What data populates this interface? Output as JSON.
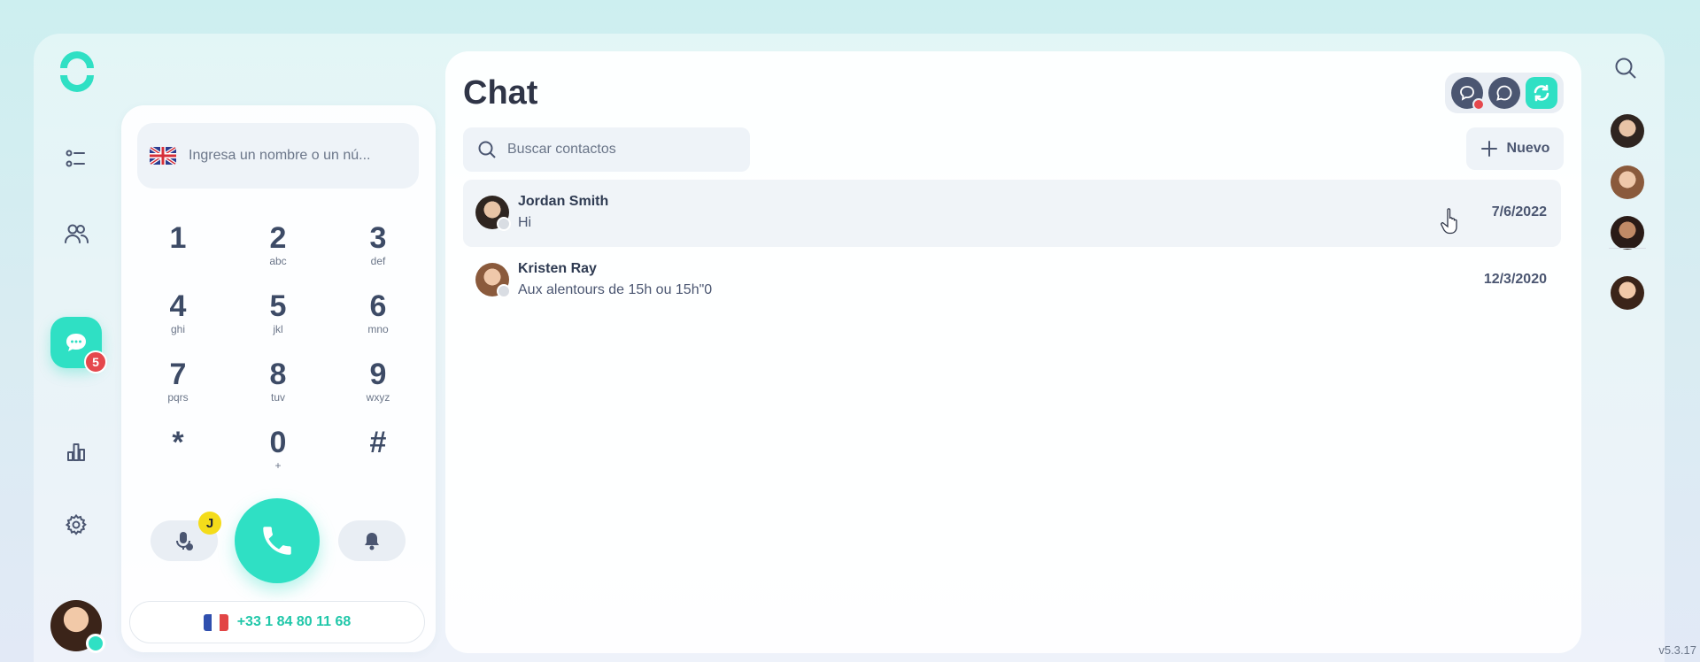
{
  "nav": {
    "items": [
      {
        "name": "list-icon"
      },
      {
        "name": "contacts-icon"
      },
      {
        "name": "chat-icon",
        "active": true,
        "badge": "5"
      },
      {
        "name": "stats-icon"
      },
      {
        "name": "settings-icon"
      }
    ]
  },
  "dialer": {
    "input_placeholder": "Ingresa un nombre o un nú...",
    "keys": [
      {
        "num": "1",
        "sub": ""
      },
      {
        "num": "2",
        "sub": "abc"
      },
      {
        "num": "3",
        "sub": "def"
      },
      {
        "num": "4",
        "sub": "ghi"
      },
      {
        "num": "5",
        "sub": "jkl"
      },
      {
        "num": "6",
        "sub": "mno"
      },
      {
        "num": "7",
        "sub": "pqrs"
      },
      {
        "num": "8",
        "sub": "tuv"
      },
      {
        "num": "9",
        "sub": "wxyz"
      },
      {
        "num": "*",
        "sub": ""
      },
      {
        "num": "0",
        "sub": "+"
      },
      {
        "num": "#",
        "sub": ""
      }
    ],
    "voicemail_badge": "J",
    "caller_id": "+33 1 84 80 11 68"
  },
  "chat": {
    "title": "Chat",
    "search_placeholder": "Buscar contactos",
    "new_label": "Nuevo",
    "conversations": [
      {
        "name": "Jordan Smith",
        "preview": "Hi",
        "date": "7/6/2022"
      },
      {
        "name": "Kristen Ray",
        "preview": "Aux alentours de 15h ou 15h\"0",
        "date": "12/3/2020"
      }
    ]
  },
  "footer": {
    "version": "v5.3.17"
  },
  "colors": {
    "accent": "#2fe0c4",
    "badge_red": "#e5484d",
    "badge_yellow": "#f4dc1a"
  }
}
